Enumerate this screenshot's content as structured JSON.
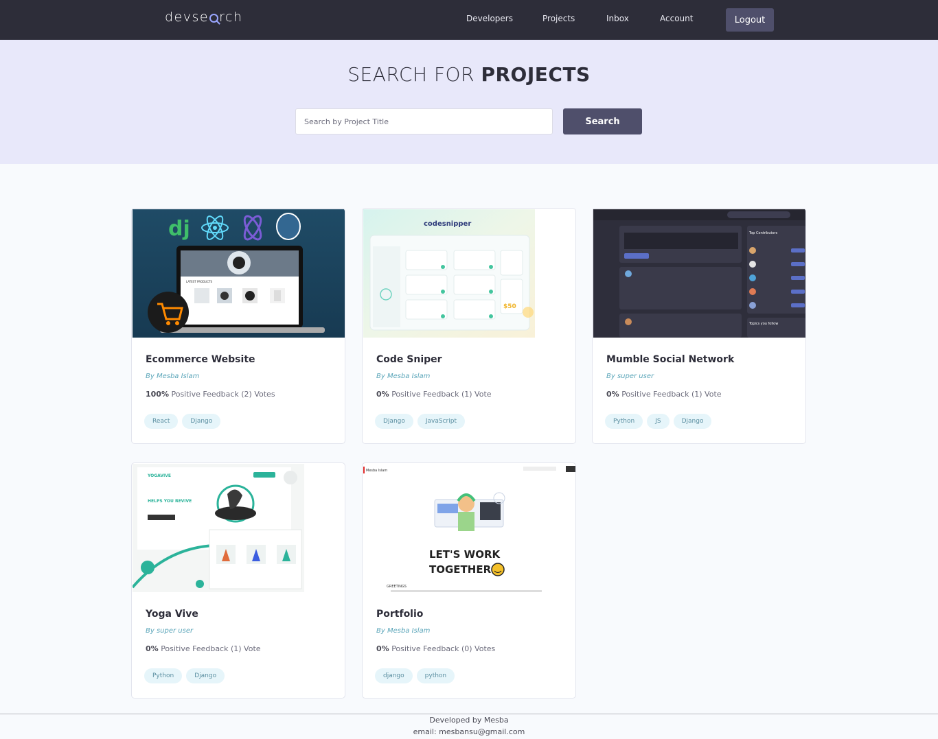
{
  "header": {
    "logo_left": "devse",
    "logo_right": "rch",
    "nav": [
      "Developers",
      "Projects",
      "Inbox",
      "Account"
    ],
    "logout_label": "Logout"
  },
  "hero": {
    "title_light": "SEARCH FOR",
    "title_bold": "PROJECTS",
    "search_placeholder": "Search by Project Title",
    "search_button": "Search"
  },
  "projects": [
    {
      "title": "Ecommerce Website",
      "author": "By Mesba Islam",
      "feedback_percent": "100%",
      "feedback_text": "Positive Feedback (2) Votes",
      "tags": [
        "React",
        "Django"
      ],
      "thumb": {
        "heading": "LATEST PRODUCTS",
        "logo": "dj"
      }
    },
    {
      "title": "Code Sniper",
      "author": "By Mesba Islam",
      "feedback_percent": "0%",
      "feedback_text": "Positive Feedback (1) Vote",
      "tags": [
        "Django",
        "JavaScript"
      ],
      "thumb": {
        "heading": "codesnipper",
        "price": "$50"
      }
    },
    {
      "title": "Mumble Social Network",
      "author": "By super user",
      "feedback_percent": "0%",
      "feedback_text": "Positive Feedback (1) Vote",
      "tags": [
        "Python",
        "JS",
        "Django"
      ],
      "thumb": {
        "heading": "Top Contributors",
        "sub": "Topics you follow"
      }
    },
    {
      "title": "Yoga Vive",
      "author": "By super user",
      "feedback_percent": "0%",
      "feedback_text": "Positive Feedback (1) Vote",
      "tags": [
        "Python",
        "Django"
      ],
      "thumb": {
        "heading": "YOGAVIVE",
        "sub": "HELPS YOU REVIVE"
      }
    },
    {
      "title": "Portfolio",
      "author": "By Mesba Islam",
      "feedback_percent": "0%",
      "feedback_text": "Positive Feedback (0) Votes",
      "tags": [
        "django",
        "python"
      ],
      "thumb": {
        "heading": "LET'S WORK",
        "heading2": "TOGETHER",
        "greeting": "GREETINGS",
        "brand": "Mesba Islam"
      }
    }
  ],
  "footer": {
    "line1": "Developed by Mesba",
    "line2": "email: mesbansu@gmail.com"
  }
}
